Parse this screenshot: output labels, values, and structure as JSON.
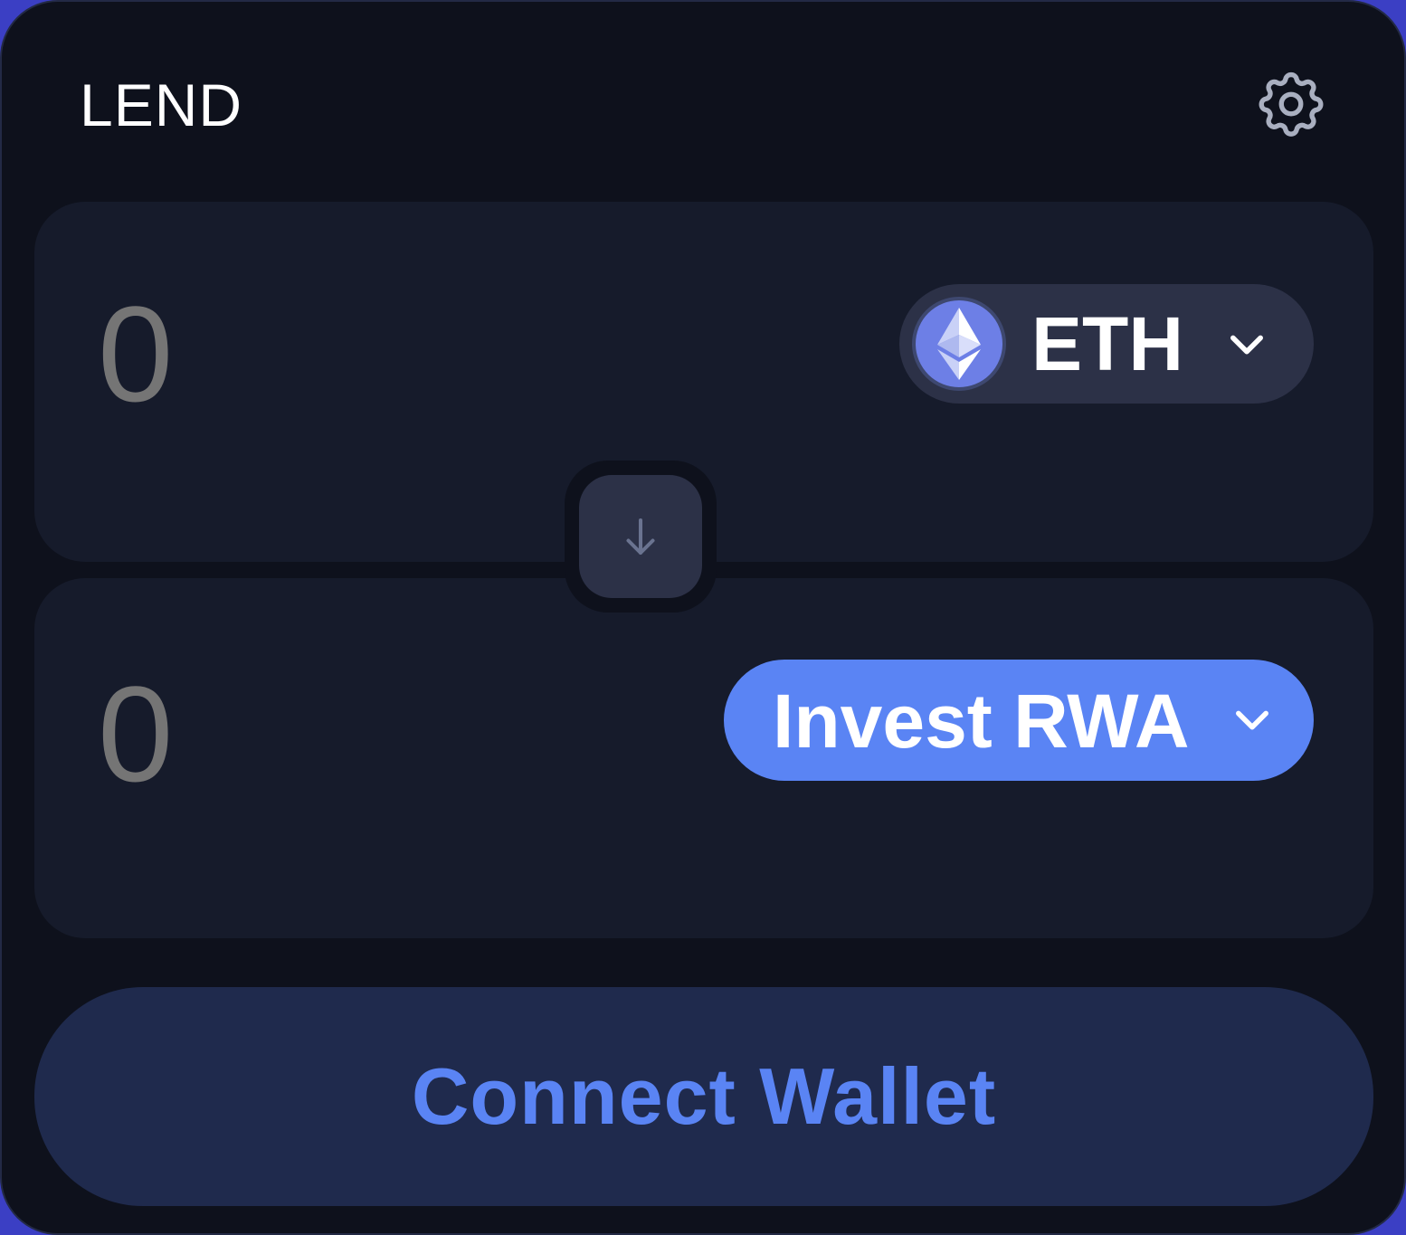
{
  "header": {
    "title": "LEND",
    "settings_icon": "gear-icon"
  },
  "from": {
    "amount": "0",
    "token": {
      "symbol": "ETH",
      "icon": "eth-logo-icon"
    }
  },
  "switch": {
    "icon": "arrow-down-icon"
  },
  "to": {
    "amount": "0",
    "selector_label": "Invest RWA"
  },
  "action": {
    "connect_label": "Connect Wallet"
  },
  "colors": {
    "accent": "#5a84f4",
    "card_background": "#0e111c",
    "panel_background": "#161b2b",
    "eth_logo": "#6d7fe6"
  }
}
